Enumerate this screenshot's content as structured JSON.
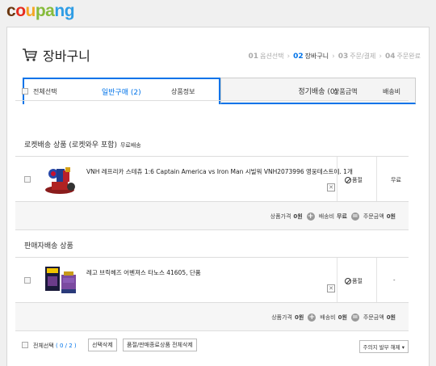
{
  "brand": {
    "logo_letters": [
      {
        "ch": "c",
        "color": "#6b3710"
      },
      {
        "ch": "o",
        "color": "#e62c1f"
      },
      {
        "ch": "u",
        "color": "#f5a623"
      },
      {
        "ch": "p",
        "color": "#86bb3b"
      },
      {
        "ch": "a",
        "color": "#86bb3b"
      },
      {
        "ch": "n",
        "color": "#2f9de5"
      },
      {
        "ch": "g",
        "color": "#2f9de5"
      }
    ]
  },
  "header": {
    "title": "장바구니",
    "icon": "cart-icon",
    "steps": [
      {
        "num": "01",
        "label": "옵션선택",
        "active": false
      },
      {
        "num": "02",
        "label": "장바구니",
        "active": true
      },
      {
        "num": "03",
        "label": "주문/결제",
        "active": false
      },
      {
        "num": "04",
        "label": "주문완료",
        "active": false
      }
    ]
  },
  "tabs": [
    {
      "label": "일반구매 (2)",
      "active": true
    },
    {
      "label": "정기배송 (0)",
      "active": false
    }
  ],
  "columns": {
    "select_all": "전체선택",
    "product_info": "상품정보",
    "price": "상품금액",
    "shipping": "배송비"
  },
  "sections": [
    {
      "title": "로켓배송 상품 (로켓와우 포함)",
      "tag": "무료배송",
      "item": {
        "name": "VNH 레프리카 스테츄 1:6 Captain America vs Iron Man 시빌워 VNH2073996 영웅테스트에. 1개",
        "status": "품절",
        "shipping": "무료"
      },
      "summary": {
        "product_price_label": "상품가격",
        "product_price": "0원",
        "shipping_label": "배송비",
        "shipping": "무료",
        "order_total_label": "주문금액",
        "order_total": "0원"
      }
    },
    {
      "title": "판매자배송 상품",
      "tag": "",
      "item": {
        "name": "레고 브릭헤즈 어벤져스 타노스 41605, 단품",
        "status": "품절",
        "shipping": "-"
      },
      "summary": {
        "product_price_label": "상품가격",
        "product_price": "0원",
        "shipping_label": "배송비",
        "shipping": "0원",
        "order_total_label": "주문금액",
        "order_total": "0원"
      }
    }
  ],
  "footer": {
    "select_all": "전체선택",
    "count": "( 0 / 2 )",
    "delete_selected": "선택삭제",
    "delete_soldout": "품절/판매종료상품 전체삭제",
    "sort_select": "주의지 발부 해제"
  }
}
